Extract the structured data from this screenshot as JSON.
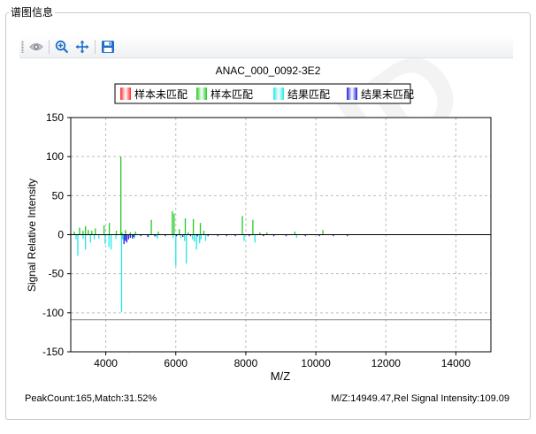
{
  "window": {
    "group_title": "谱图信息"
  },
  "toolbar": {
    "buttons": [
      {
        "name": "eye-icon",
        "tooltip": ""
      },
      {
        "name": "zoom-in-icon",
        "tooltip": ""
      },
      {
        "name": "pan-move-icon",
        "tooltip": ""
      },
      {
        "name": "save-icon",
        "tooltip": ""
      }
    ],
    "icon_color": "#1f6fc8"
  },
  "watermark": {
    "text": "MicroID"
  },
  "status": {
    "left": "PeakCount:165,Match:31.52%",
    "right": "M/Z:14949.47,Rel Signal Intensity:109.09"
  },
  "chart_data": {
    "type": "bar",
    "title": "ANAC_000_0092-3E2",
    "xlabel": "M/Z",
    "ylabel": "Signal Relative Intensity",
    "xlim": [
      3000,
      15000
    ],
    "ylim": [
      -150,
      150
    ],
    "xticks": [
      4000,
      6000,
      8000,
      10000,
      12000,
      14000
    ],
    "yticks": [
      150,
      100,
      50,
      0,
      -50,
      -100,
      -150
    ],
    "grid": true,
    "reference_line_y": -109,
    "legend_position": "top-center",
    "series": [
      {
        "name": "样本未匹配",
        "color": "#ff2a2a",
        "x": [],
        "values": []
      },
      {
        "name": "样本匹配",
        "color": "#22cc22",
        "x": [
          3100,
          3250,
          3350,
          3420,
          3500,
          3600,
          3700,
          3950,
          4100,
          4300,
          4430,
          4460,
          4560,
          4700,
          4850,
          5300,
          5500,
          5900,
          5950,
          6100,
          6270,
          6350,
          6500,
          6700,
          6800,
          7900,
          8200,
          8400,
          8600,
          9400,
          10200
        ],
        "values": [
          4,
          9,
          5,
          11,
          6,
          5,
          8,
          12,
          15,
          5,
          100,
          3,
          6,
          3,
          4,
          19,
          4,
          30,
          27,
          7,
          21,
          3,
          20,
          15,
          5,
          24,
          19,
          3,
          3,
          4,
          6
        ]
      },
      {
        "name": "结果匹配",
        "color": "#22e8e8",
        "x": [
          3150,
          3200,
          3350,
          3420,
          3560,
          3670,
          3800,
          3980,
          4090,
          4150,
          4290,
          4450,
          4480,
          4820,
          5220,
          5430,
          5480,
          5920,
          6000,
          6140,
          6250,
          6300,
          6480,
          6530,
          6590,
          6680,
          6720,
          6850,
          7950,
          8260,
          9450
        ],
        "values": [
          -6,
          -27,
          -5,
          -19,
          -10,
          -6,
          -5,
          -12,
          -16,
          -19,
          -5,
          -99,
          -6,
          -5,
          -3,
          -3,
          -5,
          -4,
          -40,
          -4,
          -8,
          -37,
          -6,
          -9,
          -19,
          -11,
          -6,
          -8,
          -8,
          -10,
          -4
        ]
      },
      {
        "name": "结果未匹配",
        "color": "#2222dd",
        "x": [
          4520,
          4560,
          4600,
          4650,
          4700,
          4760,
          4800,
          5000,
          5200,
          5400,
          5700,
          6020,
          6200,
          6420,
          6620,
          6920,
          7200,
          7450,
          7700,
          8100,
          8500,
          8800,
          9150,
          9700,
          10100,
          10500,
          10900
        ],
        "values": [
          -12,
          -8,
          -10,
          -6,
          -4,
          -5,
          -3,
          -2,
          -3,
          -2,
          -2,
          -2,
          -3,
          -2,
          -2,
          -2,
          -2,
          -2,
          -2,
          -2,
          -2,
          -2,
          -2,
          -2,
          -2,
          -2,
          -2
        ]
      }
    ]
  }
}
